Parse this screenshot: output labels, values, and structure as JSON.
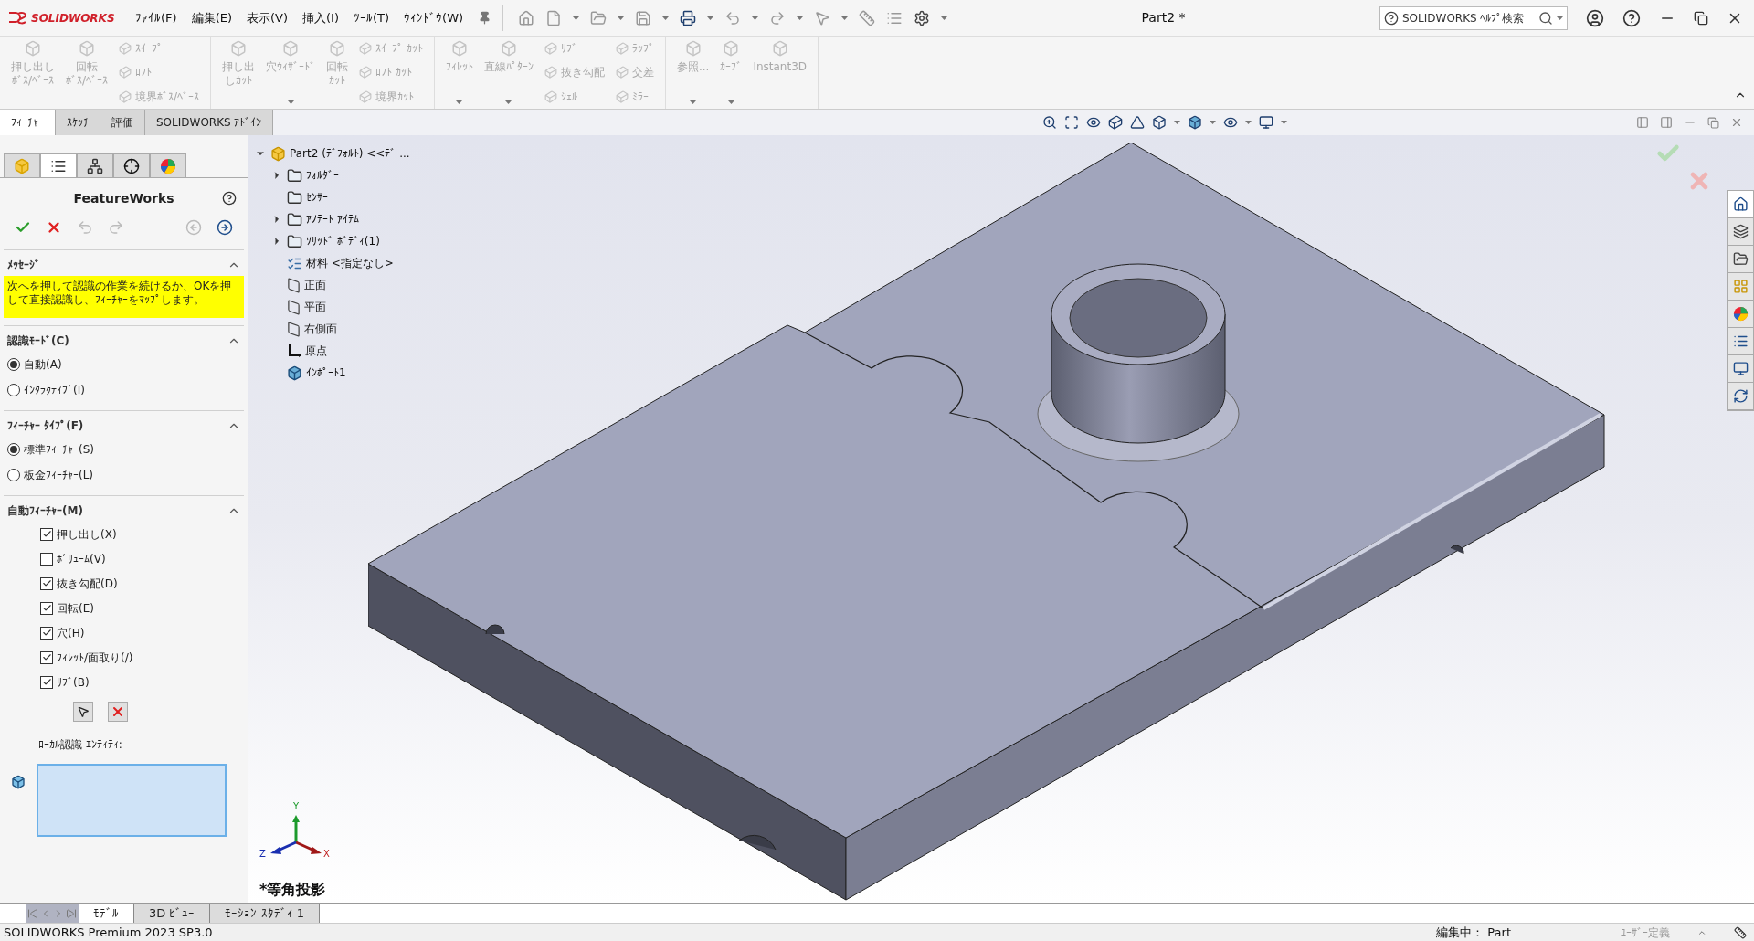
{
  "app": {
    "logo": "SOLIDWORKS"
  },
  "menu": [
    "ﾌｧｲﾙ(F)",
    "編集(E)",
    "表示(V)",
    "挿入(I)",
    "ﾂｰﾙ(T)",
    "ｳｨﾝﾄﾞｳ(W)"
  ],
  "window": {
    "title": "Part2 *"
  },
  "search": {
    "placeholder": "SOLIDWORKS ﾍﾙﾌﾟ検索"
  },
  "ribbon": [
    [
      {
        "kind": "large",
        "lines": [
          "押し出し",
          "ﾎﾞｽ/ﾍﾞｰｽ"
        ],
        "dropdown": false,
        "disabled": true
      },
      {
        "kind": "large",
        "lines": [
          "回転",
          "ﾎﾞｽ/ﾍﾞｰｽ"
        ],
        "dropdown": false,
        "disabled": true
      },
      {
        "kind": "small",
        "items": [
          {
            "label": "ｽｲｰﾌﾟ",
            "disabled": true
          },
          {
            "label": "ﾛﾌﾄ",
            "disabled": true
          },
          {
            "label": "境界ﾎﾞｽ/ﾍﾞｰｽ",
            "disabled": true
          }
        ]
      }
    ],
    [
      {
        "kind": "large",
        "lines": [
          "押し出",
          "しｶｯﾄ"
        ],
        "dropdown": false,
        "disabled": true
      },
      {
        "kind": "large",
        "lines": [
          "穴ｳｨｻﾞｰﾄﾞ"
        ],
        "dropdown": true,
        "disabled": true
      },
      {
        "kind": "large",
        "lines": [
          "回転",
          "ｶｯﾄ"
        ],
        "dropdown": false,
        "disabled": true
      },
      {
        "kind": "small",
        "items": [
          {
            "label": "ｽｲｰﾌﾟ ｶｯﾄ",
            "disabled": true
          },
          {
            "label": "ﾛﾌﾄ ｶｯﾄ",
            "disabled": true
          },
          {
            "label": "境界ｶｯﾄ",
            "disabled": true
          }
        ]
      }
    ],
    [
      {
        "kind": "large",
        "lines": [
          "ﾌｨﾚｯﾄ"
        ],
        "dropdown": true,
        "disabled": true
      },
      {
        "kind": "large",
        "lines": [
          "直線ﾊﾟﾀｰﾝ"
        ],
        "dropdown": true,
        "disabled": true
      },
      {
        "kind": "small",
        "items": [
          {
            "label": "ﾘﾌﾞ",
            "disabled": true
          },
          {
            "label": "抜き勾配",
            "disabled": true
          },
          {
            "label": "ｼｪﾙ",
            "disabled": true
          }
        ]
      },
      {
        "kind": "small",
        "items": [
          {
            "label": "ﾗｯﾌﾟ",
            "disabled": true
          },
          {
            "label": "交差",
            "disabled": true
          },
          {
            "label": "ﾐﾗｰ",
            "disabled": true
          }
        ]
      }
    ],
    [
      {
        "kind": "large",
        "lines": [
          "参照..."
        ],
        "dropdown": true,
        "disabled": true
      },
      {
        "kind": "large",
        "lines": [
          "ｶｰﾌﾞ"
        ],
        "dropdown": true,
        "disabled": true
      },
      {
        "kind": "large",
        "lines": [
          "Instant3D"
        ],
        "dropdown": false,
        "disabled": true
      }
    ]
  ],
  "tabs": [
    {
      "label": "ﾌｨｰﾁｬｰ",
      "selected": true
    },
    {
      "label": "ｽｹｯﾁ",
      "selected": false
    },
    {
      "label": "評価",
      "selected": false
    },
    {
      "label": "SOLIDWORKS ｱﾄﾞｲﾝ",
      "selected": false
    }
  ],
  "panel_tabs": [
    {
      "kind": "feature-manager",
      "selected": false
    },
    {
      "kind": "property-manager",
      "selected": true
    },
    {
      "kind": "configuration",
      "selected": false
    },
    {
      "kind": "dimxpert",
      "selected": false
    },
    {
      "kind": "display",
      "selected": false
    }
  ],
  "property_manager": {
    "title": "FeatureWorks",
    "actions": [
      {
        "kind": "ok",
        "disabled": false
      },
      {
        "kind": "cancel",
        "disabled": false
      },
      {
        "kind": "undo",
        "disabled": true
      },
      {
        "kind": "redo",
        "disabled": true
      },
      {
        "kind": "previous",
        "disabled": true
      },
      {
        "kind": "next",
        "disabled": false
      }
    ],
    "sections": [
      {
        "kind": "message",
        "title": "ﾒｯｾｰｼﾞ",
        "expanded": true,
        "text": "次へを押して認識の作業を続けるか、OKを押して直接認識し、ﾌｨｰﾁｬｰをﾏｯﾌﾟします。"
      },
      {
        "kind": "radio",
        "title": "認識ﾓｰﾄﾞ(C)",
        "expanded": true,
        "options": [
          {
            "label": "自動(A)",
            "selected": true
          },
          {
            "label": "ｲﾝﾀﾗｸﾃｨﾌﾞ(I)",
            "selected": false
          }
        ]
      },
      {
        "kind": "radio",
        "title": "ﾌｨｰﾁｬｰ ﾀｲﾌﾟ(F)",
        "expanded": true,
        "options": [
          {
            "label": "標準ﾌｨｰﾁｬｰ(S)",
            "selected": true
          },
          {
            "label": "板金ﾌｨｰﾁｬｰ(L)",
            "selected": false
          }
        ]
      },
      {
        "kind": "checkbox",
        "title": "自動ﾌｨｰﾁｬｰ(M)",
        "expanded": true,
        "options": [
          {
            "label": "押し出し(X)",
            "checked": true
          },
          {
            "label": "ﾎﾞﾘｭｰﾑ(V)",
            "checked": false
          },
          {
            "label": "抜き勾配(D)",
            "checked": true
          },
          {
            "label": "回転(E)",
            "checked": true
          },
          {
            "label": "穴(H)",
            "checked": true
          },
          {
            "label": "ﾌｨﾚｯﾄ/面取り(/)",
            "checked": true
          },
          {
            "label": "ﾘﾌﾞ(B)",
            "checked": true
          }
        ],
        "local_label": "ﾛｰｶﾙ認識 ｴﾝﾃｨﾃｨ:"
      }
    ]
  },
  "tree": [
    {
      "label": "Part2 (ﾃﾞﾌｫﾙﾄ) <<ﾃﾞ ...",
      "kind": "part",
      "expanded": true,
      "children": [
        {
          "label": "ﾌｫﾙﾀﾞｰ",
          "kind": "history-folder",
          "expanded": false
        },
        {
          "label": "ｾﾝｻｰ",
          "kind": "sensor-folder"
        },
        {
          "label": "ｱﾉﾃｰﾄ ｱｲﾃﾑ",
          "kind": "annotation-folder",
          "expanded": false
        },
        {
          "label": "ｿﾘｯﾄﾞ ﾎﾞﾃﾞｨ(1)",
          "kind": "solid-folder",
          "expanded": false
        },
        {
          "label": "材料 <指定なし>",
          "kind": "material"
        },
        {
          "label": "正面",
          "kind": "plane"
        },
        {
          "label": "平面",
          "kind": "plane"
        },
        {
          "label": "右側面",
          "kind": "plane"
        },
        {
          "label": "原点",
          "kind": "origin"
        },
        {
          "label": "ｲﾝﾎﾟｰﾄ1",
          "kind": "imported"
        }
      ]
    }
  ],
  "task_pane": [
    {
      "kind": "home",
      "selected": true
    },
    {
      "kind": "resources",
      "selected": false
    },
    {
      "kind": "library",
      "selected": false
    },
    {
      "kind": "explorer",
      "selected": false
    },
    {
      "kind": "appearance",
      "selected": false
    },
    {
      "kind": "properties",
      "selected": false
    },
    {
      "kind": "custom",
      "selected": false
    },
    {
      "kind": "forum",
      "selected": false
    }
  ],
  "triad": {
    "x": "X",
    "y": "Y",
    "z": "Z"
  },
  "view_label": "*等角投影",
  "bottom_tabs": [
    {
      "label": "ﾓﾃﾞﾙ",
      "selected": true
    },
    {
      "label": "3D ﾋﾞｭｰ",
      "selected": false
    },
    {
      "label": "ﾓｰｼｮﾝ ｽﾀﾃﾞｨ 1",
      "selected": false
    }
  ],
  "status": {
    "version": "SOLIDWORKS Premium 2023 SP3.0",
    "mode": "編集中： Part",
    "units": "ﾕｰｻﾞｰ定義"
  }
}
